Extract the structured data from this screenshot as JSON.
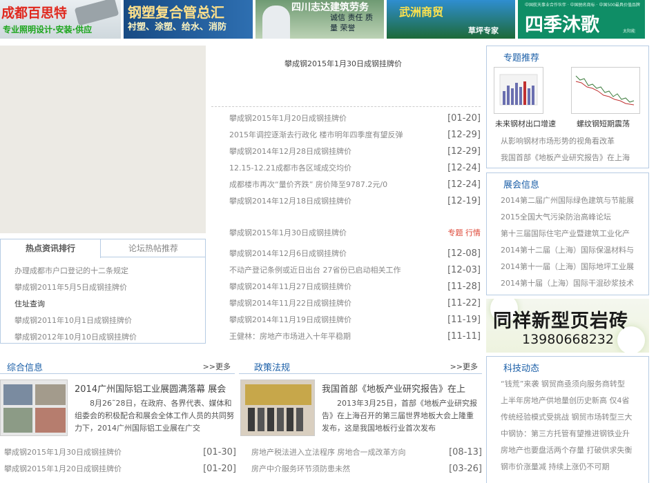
{
  "ads": {
    "a1_title": "成都百思特",
    "a1_sub": "专业照明设计·安装·供应",
    "a2_title": "钢塑复合管总汇",
    "a2_sub": "衬塑、涂塑、给水、消防",
    "a3_title": "四川志达建筑劳务",
    "a3_sub": "诚信 责任 质量 荣誉",
    "a4_title": "武洲商贸",
    "a4_sub": "草坪专家",
    "a5_small": "中国航天事业合作伙伴 · 中国驰名商标 · 中国500最具价值品牌",
    "a5_title": "四季沐歌",
    "a5_sub": "太阳能"
  },
  "hot": {
    "tab_active": "热点资讯排行",
    "tab_inactive": "论坛热帖推荐",
    "items": [
      "办理成都市户口登记的十二条规定",
      "攀成钢2011年5月5日成钢挂牌价",
      "住址查询",
      "攀成钢2011年10月1日成钢挂牌价",
      "攀成钢2012年10月10日成钢挂牌价"
    ]
  },
  "center": {
    "headline": "攀成钢2015年1月30日成钢挂牌价",
    "list_a": [
      {
        "text": "攀成钢2015年1月20日成钢挂牌价",
        "date": "[01-20]"
      },
      {
        "text": "2015年调控逐渐去行政化 楼市明年四季度有望反弹",
        "date": "[12-29]"
      },
      {
        "text": "攀成钢2014年12月28日成钢挂牌价",
        "date": "[12-29]"
      },
      {
        "text": "12.15-12.21成都市各区域成交均价",
        "date": "[12-24]"
      },
      {
        "text": "成都楼市再次“量价齐跌” 房价降至9787.2元/0",
        "date": "[12-24]"
      },
      {
        "text": "攀成钢2014年12月18日成钢挂牌价",
        "date": "[12-19]"
      }
    ],
    "list_b_head": {
      "text": "攀成钢2015年1月30日成钢挂牌价",
      "tag": "专题 行情"
    },
    "list_b": [
      {
        "text": "攀成钢2014年12月6日成钢挂牌价",
        "date": "[12-08]"
      },
      {
        "text": "不动产登记条例或近日出台 27省份已启动相关工作",
        "date": "[12-03]"
      },
      {
        "text": "攀成钢2014年11月27日成钢挂牌价",
        "date": "[11-28]"
      },
      {
        "text": "攀成钢2014年11月22日成钢挂牌价",
        "date": "[11-22]"
      },
      {
        "text": "攀成钢2014年11月19日成钢挂牌价",
        "date": "[11-19]"
      },
      {
        "text": "王健林：房地产市场进入十年平稳期",
        "date": "[11-11]"
      }
    ]
  },
  "right": {
    "box1": {
      "title": "专题推荐",
      "cap1": "未来钢材出口增速",
      "cap2": "螺纹钢短期震荡",
      "items": [
        "从影响钢材市场形势的视角看改革",
        "我国首部《地板产业研究报告》在上海"
      ]
    },
    "box2": {
      "title": "展会信息",
      "items": [
        "2014第二届广州国际绿色建筑与节能展",
        "2015全国大气污染防治高峰论坛",
        "第十三届国际住宅产业暨建筑工业化产",
        "2014第十二届（上海）国际保温材料与",
        "2014第十一届（上海）国际地坪工业展",
        "2014第十届（上海）国际干混砂浆技术"
      ]
    },
    "ad": {
      "title": "同祥新型页岩砖",
      "phone": "13980668232"
    },
    "box3": {
      "title": "科技动态",
      "items": [
        "“钱荒”来袭 钢贸商亟须向服务商转型",
        "上半年房地产供地量创历史新高 仅4省",
        "传统经验模式受挑战 钢贸市场转型三大",
        "中钢协：第三方托管有望推进钢铁业升",
        "房地产也要盘活两个存量 打破供求失衡",
        "钢市价涨量减 持续上涨仍不可期"
      ]
    }
  },
  "sections": {
    "s1": {
      "title": "综合信息",
      "more": ">>更多",
      "feat_title": "2014广州国际铝工业展圆满落幕 展会",
      "feat_desc": "8月26˜28日，在政府、各界代表、媒体和组委会的积极配合和展会全体工作人员的共同努力下，2014广州国际铝工业展在广交",
      "list": [
        {
          "text": "攀成钢2015年1月30日成钢挂牌价",
          "date": "[01-30]"
        },
        {
          "text": "攀成钢2015年1月20日成钢挂牌价",
          "date": "[01-20]"
        }
      ]
    },
    "s2": {
      "title": "政策法规",
      "more": ">>更多",
      "feat_title": "我国首部《地板产业研究报告》在上",
      "feat_desc": "2013年3月25日，首部《地板产业研究报告》在上海召开的第三届世界地板大会上隆重发布，这是我国地板行业首次发布",
      "list": [
        {
          "text": "房地产税法进入立法程序 房地合一成改革方向",
          "date": "[08-13]"
        },
        {
          "text": "房产中介服务环节须防患未然",
          "date": "[03-26]"
        }
      ]
    }
  }
}
